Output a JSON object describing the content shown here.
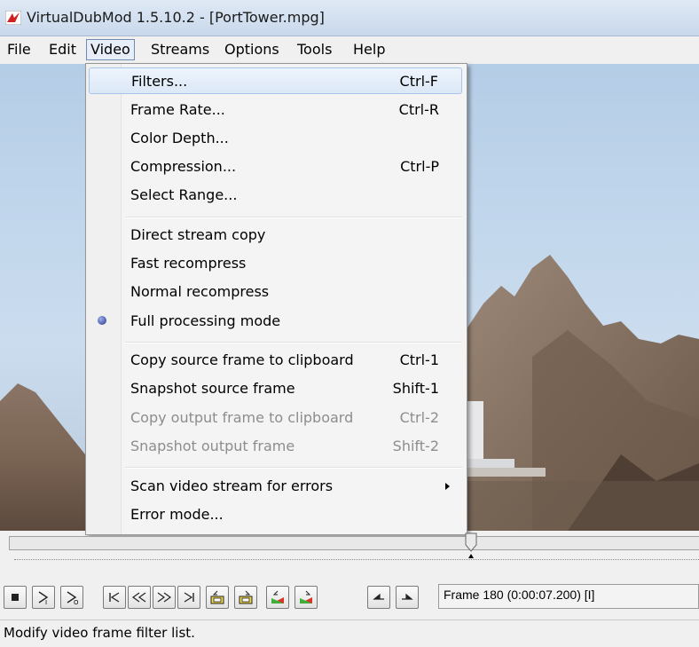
{
  "window": {
    "title": "VirtualDubMod 1.5.10.2 - [PortTower.mpg]"
  },
  "menubar": {
    "items": [
      {
        "label": "File"
      },
      {
        "label": "Edit"
      },
      {
        "label": "Video",
        "active": true
      },
      {
        "label": "Streams"
      },
      {
        "label": "Options"
      },
      {
        "label": "Tools"
      },
      {
        "label": "Help"
      }
    ]
  },
  "video_menu": {
    "items": [
      {
        "label": "Filters...",
        "shortcut": "Ctrl-F",
        "highlighted": true
      },
      {
        "label": "Frame Rate...",
        "shortcut": "Ctrl-R"
      },
      {
        "label": "Color Depth...",
        "shortcut": ""
      },
      {
        "label": "Compression...",
        "shortcut": "Ctrl-P"
      },
      {
        "label": "Select Range...",
        "shortcut": ""
      },
      {
        "label": "Direct stream copy",
        "shortcut": ""
      },
      {
        "label": "Fast recompress",
        "shortcut": ""
      },
      {
        "label": "Normal recompress",
        "shortcut": ""
      },
      {
        "label": "Full processing mode",
        "shortcut": "",
        "selected": true
      },
      {
        "label": "Copy source frame to clipboard",
        "shortcut": "Ctrl-1"
      },
      {
        "label": "Snapshot source frame",
        "shortcut": "Shift-1"
      },
      {
        "label": "Copy output frame to clipboard",
        "shortcut": "Ctrl-2",
        "disabled": true
      },
      {
        "label": "Snapshot output frame",
        "shortcut": "Shift-2",
        "disabled": true
      },
      {
        "label": "Scan video stream for errors",
        "shortcut": "",
        "submenu": true
      },
      {
        "label": "Error mode...",
        "shortcut": ""
      }
    ]
  },
  "toolbar": {
    "buttons": [
      "stop",
      "play-input",
      "play-output",
      "start",
      "prev-frame",
      "next-frame",
      "end",
      "prev-keyframe",
      "next-keyframe",
      "prev-scene",
      "next-scene",
      "mark-in",
      "mark-out"
    ],
    "frame_readout": "Frame 180 (0:00:07.200) [I]"
  },
  "seek": {
    "position_fraction": 0.67
  },
  "status": {
    "text": "Modify video frame filter list."
  }
}
